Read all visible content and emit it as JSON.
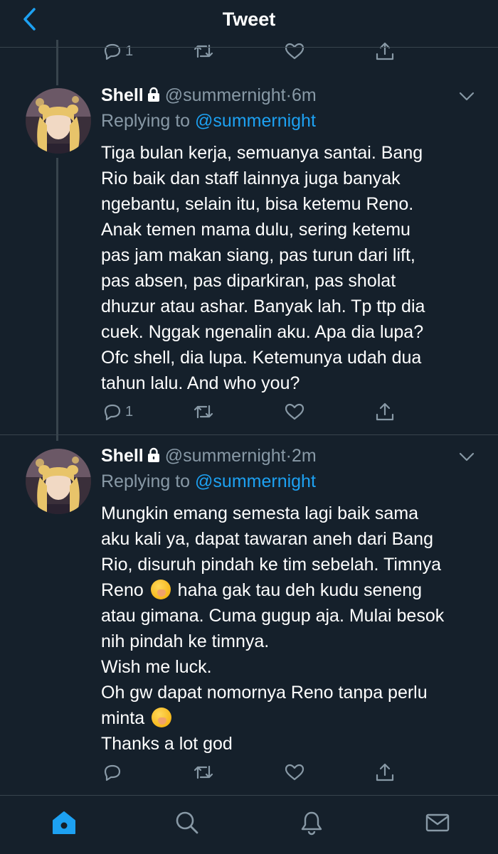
{
  "header": {
    "title": "Tweet"
  },
  "colors": {
    "background": "#15202b",
    "accent": "#1da1f2",
    "secondary_text": "#8899a6",
    "divider": "#38444d"
  },
  "previous_actions": {
    "reply_count": "1"
  },
  "tweets": [
    {
      "name": "Shell",
      "handle": "@summernight",
      "dot": "·",
      "time": "6m",
      "replying_prefix": "Replying to",
      "replying_to": "@summernight",
      "lines": [
        "Tiga bulan kerja, semuanya santai. Bang",
        "Rio baik dan staff lainnya juga banyak",
        "ngebantu, selain itu, bisa ketemu Reno.",
        "Anak temen mama dulu, sering ketemu",
        "pas jam makan siang, pas turun dari lift,",
        "pas absen, pas diparkiran, pas sholat",
        "dhuzur atau ashar. Banyak lah. Tp ttp dia",
        "cuek. Nggak ngenalin aku. Apa dia lupa?",
        "Ofc shell, dia lupa. Ketemunya udah dua",
        "tahun lalu. And who you?"
      ],
      "reply_count": "1"
    },
    {
      "name": "Shell",
      "handle": "@summernight",
      "dot": "·",
      "time": "2m",
      "replying_prefix": "Replying to",
      "replying_to": "@summernight",
      "lines": [
        "Mungkin emang semesta lagi baik sama",
        "aku kali ya, dapat tawaran aneh dari Bang",
        "Rio, disuruh pindah ke tim sebelah. Timnya",
        "Reno",
        "haha gak tau deh kudu seneng",
        "atau gimana. Cuma gugup aja. Mulai besok",
        "nih pindah ke timnya.",
        "Wish me luck.",
        "Oh gw dapat nomornya Reno tanpa perlu",
        "minta",
        "Thanks a lot god"
      ],
      "reply_count": ""
    }
  ],
  "icons": [
    "back-chevron-icon",
    "reply-icon",
    "retweet-icon",
    "like-icon",
    "share-icon",
    "lock-icon",
    "chevron-down-icon",
    "home-icon",
    "search-icon",
    "notifications-icon",
    "messages-icon",
    "hand-over-mouth-emoji"
  ]
}
